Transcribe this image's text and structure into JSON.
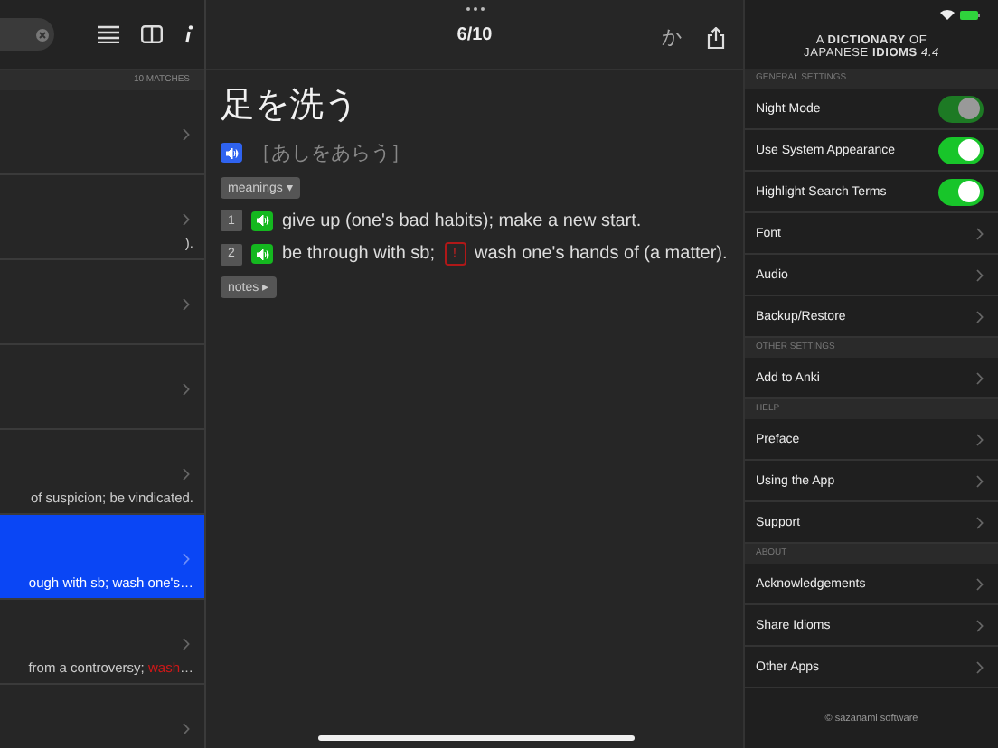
{
  "list_pane": {
    "match_count": "10 MATCHES",
    "rows": [
      {
        "selected": false,
        "snippet": []
      },
      {
        "selected": false,
        "snippet": [
          {
            "text": ").",
            "highlight": false
          }
        ]
      },
      {
        "selected": false,
        "snippet": []
      },
      {
        "selected": false,
        "snippet": []
      },
      {
        "selected": false,
        "snippet": [
          {
            "text": "of suspicion; be vindicated.",
            "highlight": false
          }
        ]
      },
      {
        "selected": true,
        "snippet": [
          {
            "text": "ough with sb; wash one's…",
            "highlight": false
          }
        ]
      },
      {
        "selected": false,
        "snippet": [
          {
            "text": "from a controversy; ",
            "highlight": false
          },
          {
            "text": "wash",
            "highlight": true
          },
          {
            "text": "…",
            "highlight": false
          }
        ]
      },
      {
        "selected": false,
        "snippet": []
      }
    ]
  },
  "entry": {
    "position": "6/10",
    "kana_button": "か",
    "title": "足を洗う",
    "reading": "［あしをあらう］",
    "meanings_button": "meanings ▾",
    "notes_button": "notes ▸",
    "meanings": [
      {
        "number": "1",
        "text": "give up (one's bad habits); make a new start.",
        "warning": false
      },
      {
        "number": "2",
        "text": "be through with sb;",
        "warning": true,
        "warning_mark": "!",
        "rest": "wash one's hands of (a matter)."
      }
    ]
  },
  "settings": {
    "logo_line_1": "A **DICTIONARY** OF",
    "logo_line_2": "JAPANESE **IDIOMS** *4.4*",
    "sections": [
      {
        "header": "GENERAL SETTINGS",
        "items": [
          {
            "kind": "toggle",
            "label": "Night Mode",
            "on": true,
            "disabled": true
          },
          {
            "kind": "toggle",
            "label": "Use System Appearance",
            "on": true,
            "disabled": false
          },
          {
            "kind": "toggle",
            "label": "Highlight Search Terms",
            "on": true,
            "disabled": false
          },
          {
            "kind": "link",
            "label": "Font"
          },
          {
            "kind": "link",
            "label": "Audio"
          },
          {
            "kind": "link",
            "label": "Backup/Restore"
          }
        ]
      },
      {
        "header": "OTHER SETTINGS",
        "items": [
          {
            "kind": "link",
            "label": "Add to Anki"
          }
        ]
      },
      {
        "header": "HELP",
        "items": [
          {
            "kind": "link",
            "label": "Preface"
          },
          {
            "kind": "link",
            "label": "Using the App"
          },
          {
            "kind": "link",
            "label": "Support"
          }
        ]
      },
      {
        "header": "ABOUT",
        "items": [
          {
            "kind": "link",
            "label": "Acknowledgements"
          },
          {
            "kind": "link",
            "label": "Share Idioms"
          },
          {
            "kind": "link",
            "label": "Other Apps"
          }
        ]
      }
    ],
    "footer": "© sazanami software"
  }
}
